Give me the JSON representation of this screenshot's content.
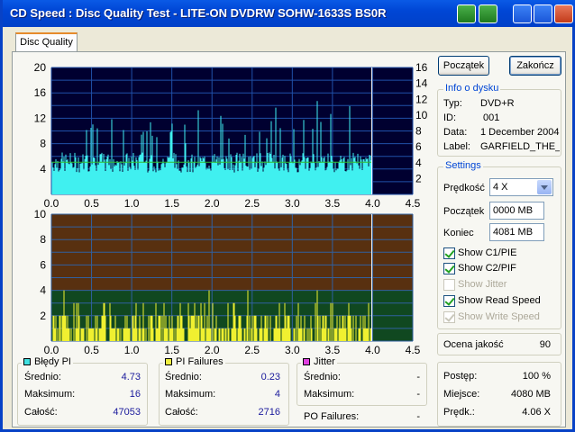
{
  "window": {
    "title": "CD Speed : Disc Quality Test - LITE-ON DVDRW SOHW-1633S BS0R"
  },
  "tab": {
    "label": "Disc Quality"
  },
  "buttons": {
    "start": "Początek",
    "end": "Zakończ"
  },
  "disc_info": {
    "title": "Info o dysku",
    "rows": [
      {
        "label": "Typ:",
        "value": "DVD+R"
      },
      {
        "label": "ID:",
        "value": "001"
      },
      {
        "label": "Data:",
        "value": "1 December 2004"
      },
      {
        "label": "Label:",
        "value": "GARFIELD_THE_I"
      }
    ]
  },
  "settings": {
    "title": "Settings",
    "speed_label": "Prędkość",
    "speed_value": "4 X",
    "start_label": "Początek",
    "start_value": "0000 MB",
    "end_label": "Koniec",
    "end_value": "4081 MB",
    "checkboxes": [
      {
        "label": "Show C1/PIE",
        "checked": true,
        "enabled": true
      },
      {
        "label": "Show C2/PIF",
        "checked": true,
        "enabled": true
      },
      {
        "label": "Show Jitter",
        "checked": false,
        "enabled": false
      },
      {
        "label": "Show Read Speed",
        "checked": true,
        "enabled": true
      },
      {
        "label": "Show Write Speed",
        "checked": true,
        "enabled": false
      }
    ]
  },
  "quality": {
    "label": "Ocena jakość",
    "value": "90"
  },
  "progress": {
    "rows": [
      {
        "label": "Postęp:",
        "value": "100 %"
      },
      {
        "label": "Miejsce:",
        "value": "4080 MB"
      },
      {
        "label": "Prędk.:",
        "value": "4.06 X"
      }
    ]
  },
  "stats": {
    "pi_errors": {
      "title": "Błędy PI",
      "color": "#40e0e0",
      "rows": [
        {
          "label": "Średnio:",
          "value": "4.73"
        },
        {
          "label": "Maksimum:",
          "value": "16"
        },
        {
          "label": "Całość:",
          "value": "47053"
        }
      ]
    },
    "pi_failures": {
      "title": "PI Failures",
      "color": "#f0f040",
      "rows": [
        {
          "label": "Średnio:",
          "value": "0.23"
        },
        {
          "label": "Maksimum:",
          "value": "4"
        },
        {
          "label": "Całość:",
          "value": "2716"
        }
      ]
    },
    "jitter": {
      "title": "Jitter",
      "color": "#e040e0",
      "rows": [
        {
          "label": "Średnio:",
          "value": "-"
        },
        {
          "label": "Maksimum:",
          "value": "-"
        }
      ],
      "po_label": "PO Failures:",
      "po_value": "-"
    }
  },
  "chart_data": [
    {
      "type": "bar",
      "name": "PI errors with read speed",
      "x_ticks": [
        "0.0",
        "0.5",
        "1.0",
        "1.5",
        "2.0",
        "2.5",
        "3.0",
        "3.5",
        "4.0",
        "4.5"
      ],
      "y_ticks_left": [
        "20",
        "16",
        "12",
        "8",
        "4"
      ],
      "y_ticks_right": [
        "16",
        "14",
        "12",
        "10",
        "8",
        "6",
        "4",
        "2"
      ],
      "xlim": [
        0,
        4.5
      ],
      "ylim_left": [
        0,
        20
      ],
      "ylim_right": [
        0,
        16
      ],
      "data_end_x": 3.99,
      "pi_avg": 4.73,
      "pi_max": 16,
      "read_speed": 4.06,
      "colors": {
        "background": "#000030",
        "grid": "#2050a8",
        "bars": "#40f0f0",
        "speed": "#30c030"
      }
    },
    {
      "type": "bar",
      "name": "PI failures",
      "x_ticks": [
        "0.0",
        "0.5",
        "1.0",
        "1.5",
        "2.0",
        "2.5",
        "3.0",
        "3.5",
        "4.0",
        "4.5"
      ],
      "y_ticks_left": [
        "10",
        "8",
        "6",
        "4",
        "2"
      ],
      "xlim": [
        0,
        4.5
      ],
      "ylim_left": [
        0,
        10
      ],
      "threshold": 4,
      "data_end_x": 3.99,
      "pif_avg": 0.23,
      "pif_max": 4,
      "colors": {
        "upper": "#583010",
        "lower": "#104820",
        "grid": "#3060a0",
        "bars": "#f0f030"
      }
    }
  ]
}
